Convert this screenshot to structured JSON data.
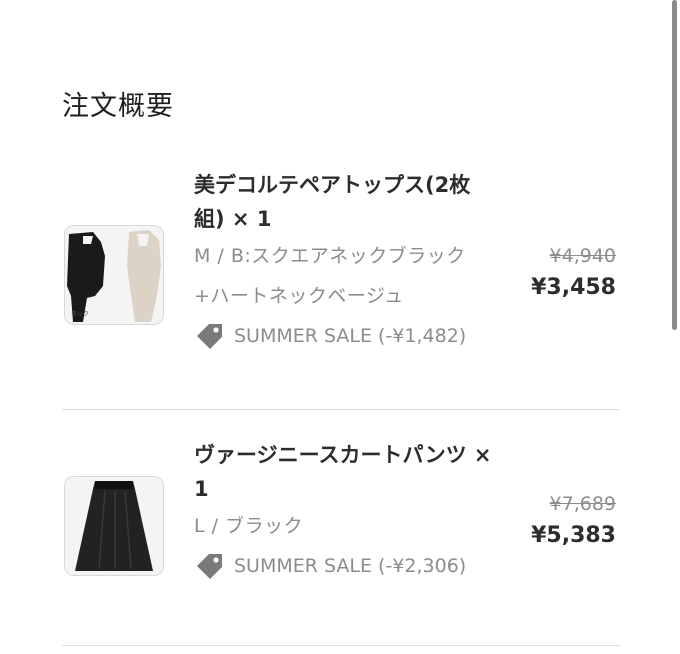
{
  "summary": {
    "title": "注文概要"
  },
  "items": [
    {
      "name": "美デコルテペアトップス(2枚組) × 1",
      "variant": "M / B:スクエアネックブラック+ハートネックベージュ",
      "discount": "SUMMER SALE (-¥1,482)",
      "original_price": "¥4,940",
      "final_price": "¥3,458",
      "icon": "price-tag-icon"
    },
    {
      "name": "ヴァージニースカートパンツ × 1",
      "variant": "L / ブラック",
      "discount": "SUMMER SALE (-¥2,306)",
      "original_price": "¥7,689",
      "final_price": "¥5,383",
      "icon": "price-tag-icon"
    }
  ],
  "colors": {
    "text": "#2d2d2d",
    "muted": "#8c8c8c",
    "divider": "#dcdcdc",
    "tag": "#7a7a7a"
  }
}
